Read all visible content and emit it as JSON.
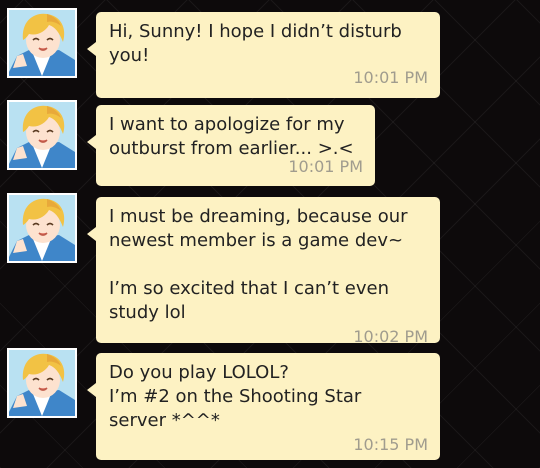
{
  "messages": [
    {
      "text": "Hi, Sunny! I hope I didn’t disturb\nyou!",
      "time": "10:01 PM"
    },
    {
      "text": "I want to apologize for my\noutburst from earlier... >.<",
      "time": "10:01 PM"
    },
    {
      "text": "I must be dreaming, because our\nnewest member is a game dev~\n\nI’m so excited that I can’t even\nstudy lol",
      "time": "10:02 PM"
    },
    {
      "text": "Do you play LOLOL?\nI’m #2 on the Shooting Star\nserver *^^*",
      "time": "10:15 PM"
    }
  ],
  "avatar_icon": "character-avatar-icon",
  "colors": {
    "bubble": "#fdf2c3",
    "timestamp": "#a09c8e",
    "background": "#0d0a0b"
  }
}
